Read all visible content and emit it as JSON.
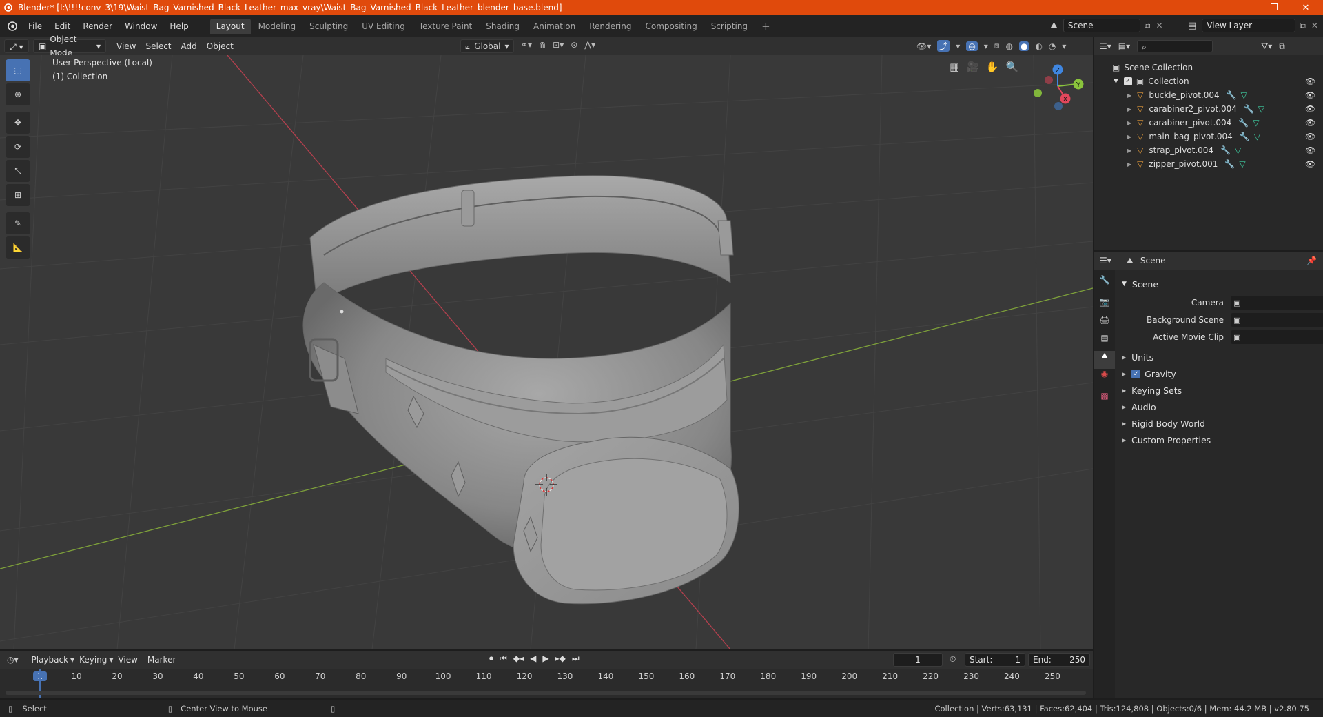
{
  "titlebar": {
    "title": "Blender* [I:\\!!!!conv_3\\19\\Waist_Bag_Varnished_Black_Leather_max_vray\\Waist_Bag_Varnished_Black_Leather_blender_base.blend]",
    "minimize": "—",
    "maximize": "❐",
    "close": "✕"
  },
  "menu": [
    "File",
    "Edit",
    "Render",
    "Window",
    "Help"
  ],
  "workspaces": [
    "Layout",
    "Modeling",
    "Sculpting",
    "UV Editing",
    "Texture Paint",
    "Shading",
    "Animation",
    "Rendering",
    "Compositing",
    "Scripting"
  ],
  "workspace_add": "+",
  "scene_selector": "Scene",
  "view_layer_selector": "View Layer",
  "viewport_header": {
    "mode": "Object Mode",
    "menus": [
      "View",
      "Select",
      "Add",
      "Object"
    ],
    "orientation": "Global"
  },
  "viewport": {
    "perspective": "User Perspective (Local)",
    "collection": "(1) Collection",
    "gizmo": {
      "x": "X",
      "y": "Y",
      "z": "Z"
    }
  },
  "outliner": {
    "root": "Scene Collection",
    "collection": "Collection",
    "items": [
      "buckle_pivot.004",
      "carabiner2_pivot.004",
      "carabiner_pivot.004",
      "main_bag_pivot.004",
      "strap_pivot.004",
      "zipper_pivot.001"
    ]
  },
  "properties": {
    "header": "Scene",
    "panel": "Scene",
    "fields": [
      {
        "label": "Camera",
        "value": ""
      },
      {
        "label": "Background Scene",
        "value": ""
      },
      {
        "label": "Active Movie Clip",
        "value": ""
      }
    ],
    "sections": [
      "Units",
      "Gravity",
      "Keying Sets",
      "Audio",
      "Rigid Body World",
      "Custom Properties"
    ],
    "gravity_checked": true
  },
  "timeline": {
    "menus": [
      "Playback",
      "Keying",
      "View",
      "Marker"
    ],
    "current_frame": "1",
    "start_label": "Start:",
    "start": "1",
    "end_label": "End:",
    "end": "250",
    "ticks": [
      "1",
      "10",
      "20",
      "30",
      "40",
      "50",
      "60",
      "70",
      "80",
      "90",
      "100",
      "110",
      "120",
      "130",
      "140",
      "150",
      "160",
      "170",
      "180",
      "190",
      "200",
      "210",
      "220",
      "230",
      "240",
      "250"
    ]
  },
  "statusbar": {
    "left": "Select",
    "middle": "Center View to Mouse",
    "stats": "Collection | Verts:63,131 | Faces:62,404 | Tris:124,808 | Objects:0/6 | Mem: 44.2 MB | v2.80.75"
  },
  "colors": {
    "accent": "#4772b3",
    "titlebar": "#e04a0c",
    "object_icon": "#e39a3a",
    "modifier_icon": "#6aa7e8",
    "mesh_icon": "#3fd1a4",
    "axis_x": "#e2475c",
    "axis_y": "#8ac43c",
    "axis_z": "#3f86e0"
  }
}
